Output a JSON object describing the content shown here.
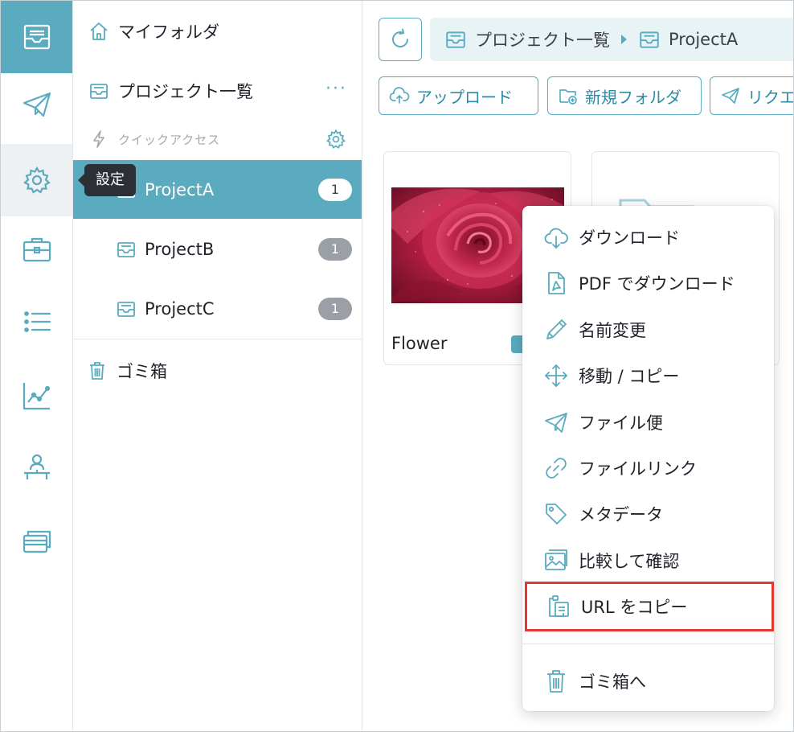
{
  "colors": {
    "accent": "#5aabbf",
    "accent_dark": "#2c8aa3",
    "highlight_border": "#e03b2e",
    "badge_gray": "#9aa0a6"
  },
  "rail": {
    "items": [
      {
        "icon": "inbox-icon",
        "active": true
      },
      {
        "icon": "paper-plane-icon"
      },
      {
        "icon": "gear-icon",
        "hover": true
      },
      {
        "icon": "briefcase-icon"
      },
      {
        "icon": "list-icon"
      },
      {
        "icon": "line-chart-icon"
      },
      {
        "icon": "org-chart-icon"
      },
      {
        "icon": "cards-icon"
      }
    ],
    "tooltip": "設定"
  },
  "sidebar": {
    "my_folder": "マイフォルダ",
    "project_list": "プロジェクト一覧",
    "more_label": "···",
    "quick_access": "クイックアクセス",
    "projects": [
      {
        "name": "ProjectA",
        "count": "1",
        "active": true
      },
      {
        "name": "ProjectB",
        "count": "1"
      },
      {
        "name": "ProjectC",
        "count": "1"
      }
    ],
    "trash": "ゴミ箱"
  },
  "main": {
    "breadcrumb": [
      "プロジェクト一覧",
      "ProjectA"
    ],
    "toolbar": {
      "upload": "アップロード",
      "new_folder": "新規フォルダ",
      "request": "リクエ"
    },
    "files": [
      {
        "name": "Flower",
        "type": "image"
      }
    ]
  },
  "context_menu": {
    "items": [
      {
        "label": "ダウンロード",
        "icon": "cloud-download-icon"
      },
      {
        "label": "PDF でダウンロード",
        "icon": "pdf-file-icon"
      },
      {
        "label": "名前変更",
        "icon": "pencil-icon"
      },
      {
        "label": "移動 / コピー",
        "icon": "move-arrows-icon"
      },
      {
        "label": "ファイル便",
        "icon": "paper-plane-icon"
      },
      {
        "label": "ファイルリンク",
        "icon": "link-icon"
      },
      {
        "label": "メタデータ",
        "icon": "tag-icon"
      },
      {
        "label": "比較して確認",
        "icon": "compare-image-icon"
      },
      {
        "label": "URL をコピー",
        "icon": "clipboard-copy-icon",
        "highlighted": true
      }
    ],
    "trash_item": {
      "label": "ゴミ箱へ",
      "icon": "trash-icon"
    }
  }
}
